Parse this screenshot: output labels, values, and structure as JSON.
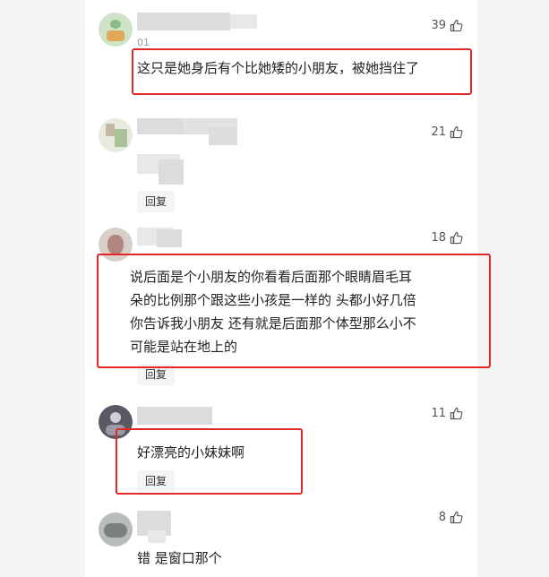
{
  "comments": [
    {
      "likes": "39",
      "date": "01",
      "text": "这只是她身后有个比她矮的小朋友，被她挡住了",
      "highlighted": true
    },
    {
      "likes": "21",
      "text": "",
      "reply_label": "回复"
    },
    {
      "likes": "18",
      "lines": [
        "说后面是个小朋友的你看看后面那个眼睛眉毛耳",
        "朵的比例那个跟这些小孩是一样的 头都小好几倍",
        "你告诉我小朋友 还有就是后面那个体型那么小不",
        "可能是站在地上的"
      ],
      "reply_label": "回复",
      "highlighted": true
    },
    {
      "likes": "11",
      "text": "好漂亮的小妹妹啊",
      "reply_label": "回复",
      "highlighted": true
    },
    {
      "likes": "8",
      "text": "错 是窗口那个"
    }
  ],
  "colors": {
    "highlight": "#e32626",
    "background": "#f4f4f4"
  },
  "icons": {
    "like": "thumbs-up-icon"
  }
}
